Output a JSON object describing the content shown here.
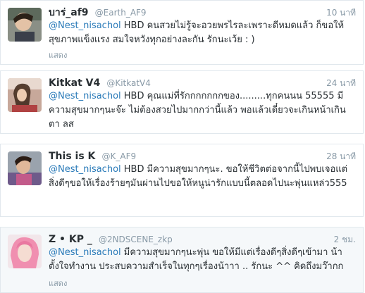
{
  "tweets": [
    {
      "name": "บาร่_af9",
      "handle": "@Earth_AF9",
      "time": "10 นาที",
      "mention": "@Nest_nisachol",
      "text": " HBD คนสวยไม่รู้จะอวยพรไรละเพราะดีหมดแล้ว ก็ขอให้สุขภาพแข็งแรง สมใจหวังทุกอย่างละกัน รักนะเว้ย : )",
      "expand": "แสดง"
    },
    {
      "name": "Kitkat V4",
      "handle": "@KitkatV4",
      "time": "24 นาที",
      "mention": "@Nest_nisachol",
      "text": " HBD คุณแม่ที่รักกกกกกกของ.........ทุกคนนน 55555 มีความสุขมากๆนะจ๊ะ ไม่ต้องสวยไปมากกว่านี้แล้ว พอแล้วเดี๋ยวจะเกินหน้าเกิน ตา ลส",
      "expand": ""
    },
    {
      "name": "This is K",
      "handle": "@K_AF9",
      "time": "28 นาที",
      "mention": "@Nest_nisachol",
      "text": " HBD มีความสุขมากๆนะ. ขอให้ชีวิตต่อจากนี้ไปพบเจอแต่สิ่งดีๆขอให้เรื่องร้ายๆมันผ่านไปขอให้หนูน่ารักแบบนี้ตลอดไปนะพุ่นแหล่ว555",
      "expand": ""
    },
    {
      "name": "Z • KP _",
      "handle": "@2NDSCENE_zkp",
      "time": "2 ชม.",
      "mention": "@Nest_nisachol",
      "text": " มีความสุขมากๆนะพุ่น ขอให้มีแต่เรื่องดีๆสิ่งดีๆเข้ามา น้า ตั้งใจทำงาน ประสบความสำเร็จในทุกๆเรื่องน้าาา .. รักนะ ^^ คิดถึงมว๊ากก",
      "expand": "แสดง"
    }
  ]
}
